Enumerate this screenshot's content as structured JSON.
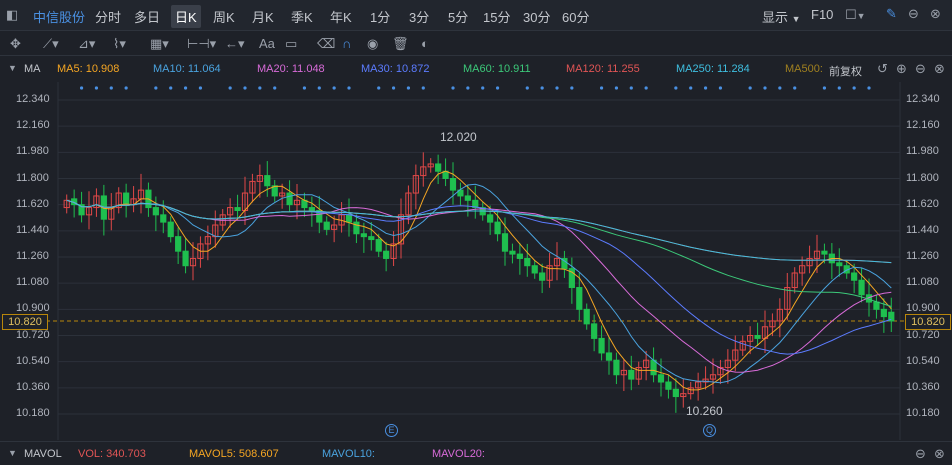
{
  "topbar": {
    "stock_name": "中信股份",
    "tabs": [
      "分时",
      "多日",
      "日K",
      "周K",
      "月K",
      "季K",
      "年K",
      "1分",
      "3分",
      "5分",
      "15分",
      "30分",
      "60分"
    ],
    "active_tab": "日K",
    "display_label": "显示",
    "f10_label": "F10"
  },
  "toolbar": {
    "text_tool": "Aa"
  },
  "ma_bar": {
    "title": "MA",
    "ma5": "MA5: 10.908",
    "ma10": "MA10: 11.064",
    "ma20": "MA20: 11.048",
    "ma30": "MA30: 10.872",
    "ma60": "MA60: 10.911",
    "ma120": "MA120: 11.255",
    "ma250": "MA250: 11.284",
    "ma500": "MA500:",
    "adjust": "前复权"
  },
  "y_axis": [
    "12.340",
    "12.160",
    "11.980",
    "11.800",
    "11.620",
    "11.440",
    "11.260",
    "11.080",
    "10.900",
    "10.720",
    "10.540",
    "10.360",
    "10.180"
  ],
  "current_price": "10.820",
  "annotations": {
    "high": "12.020",
    "low": "10.260",
    "marker_e": "E",
    "marker_q": "Q"
  },
  "vol_bar": {
    "title": "MAVOL",
    "vol": "VOL: 340.703",
    "mavol5": "MAVOL5: 508.607",
    "mavol10": "MAVOL10:",
    "mavol20": "MAVOL20:"
  },
  "colors": {
    "up": "#e04848",
    "down": "#1fbf4f",
    "ma5": "#f5a623",
    "ma10": "#4aa3df",
    "ma20": "#d86bd8",
    "ma30": "#5c7cff",
    "ma60": "#3cc879",
    "ma120": "#e05555",
    "ma250": "#3fbfe0",
    "ma500": "#a08020"
  },
  "chart_data": {
    "type": "candlestick",
    "ylim": [
      10.18,
      12.34
    ],
    "closes": [
      11.65,
      11.62,
      11.55,
      11.6,
      11.68,
      11.52,
      11.6,
      11.7,
      11.62,
      11.66,
      11.72,
      11.6,
      11.55,
      11.5,
      11.4,
      11.3,
      11.2,
      11.25,
      11.35,
      11.4,
      11.48,
      11.55,
      11.6,
      11.58,
      11.7,
      11.78,
      11.82,
      11.75,
      11.68,
      11.7,
      11.62,
      11.65,
      11.6,
      11.58,
      11.5,
      11.45,
      11.48,
      11.55,
      11.5,
      11.42,
      11.4,
      11.38,
      11.3,
      11.25,
      11.35,
      11.55,
      11.7,
      11.82,
      11.88,
      11.9,
      11.85,
      11.8,
      11.72,
      11.68,
      11.65,
      11.6,
      11.55,
      11.5,
      11.42,
      11.3,
      11.28,
      11.25,
      11.2,
      11.15,
      11.1,
      11.2,
      11.25,
      11.18,
      11.05,
      10.9,
      10.8,
      10.7,
      10.6,
      10.55,
      10.45,
      10.48,
      10.42,
      10.5,
      10.55,
      10.45,
      10.4,
      10.35,
      10.3,
      10.32,
      10.36,
      10.4,
      10.42,
      10.45,
      10.5,
      10.55,
      10.62,
      10.68,
      10.72,
      10.7,
      10.78,
      10.82,
      10.9,
      11.05,
      11.15,
      11.2,
      11.25,
      11.3,
      11.28,
      11.22,
      11.2,
      11.15,
      11.1,
      11.0,
      10.95,
      10.9,
      10.85,
      10.82
    ],
    "opens": [
      11.6,
      11.66,
      11.62,
      11.55,
      11.6,
      11.68,
      11.52,
      11.6,
      11.7,
      11.62,
      11.66,
      11.72,
      11.6,
      11.55,
      11.5,
      11.4,
      11.3,
      11.2,
      11.25,
      11.35,
      11.4,
      11.48,
      11.55,
      11.6,
      11.58,
      11.7,
      11.78,
      11.82,
      11.75,
      11.68,
      11.7,
      11.62,
      11.65,
      11.6,
      11.58,
      11.5,
      11.45,
      11.48,
      11.55,
      11.5,
      11.42,
      11.4,
      11.38,
      11.3,
      11.25,
      11.35,
      11.55,
      11.7,
      11.82,
      11.88,
      11.9,
      11.85,
      11.8,
      11.72,
      11.68,
      11.65,
      11.6,
      11.55,
      11.5,
      11.42,
      11.3,
      11.28,
      11.25,
      11.2,
      11.15,
      11.1,
      11.2,
      11.25,
      11.18,
      11.05,
      10.9,
      10.8,
      10.7,
      10.6,
      10.55,
      10.45,
      10.48,
      10.42,
      10.5,
      10.55,
      10.45,
      10.4,
      10.35,
      10.3,
      10.32,
      10.36,
      10.4,
      10.42,
      10.45,
      10.5,
      10.55,
      10.62,
      10.68,
      10.72,
      10.7,
      10.78,
      10.82,
      10.9,
      11.05,
      11.15,
      11.2,
      11.25,
      11.3,
      11.28,
      11.22,
      11.2,
      11.15,
      11.1,
      11.0,
      10.95,
      10.9,
      10.88
    ]
  }
}
